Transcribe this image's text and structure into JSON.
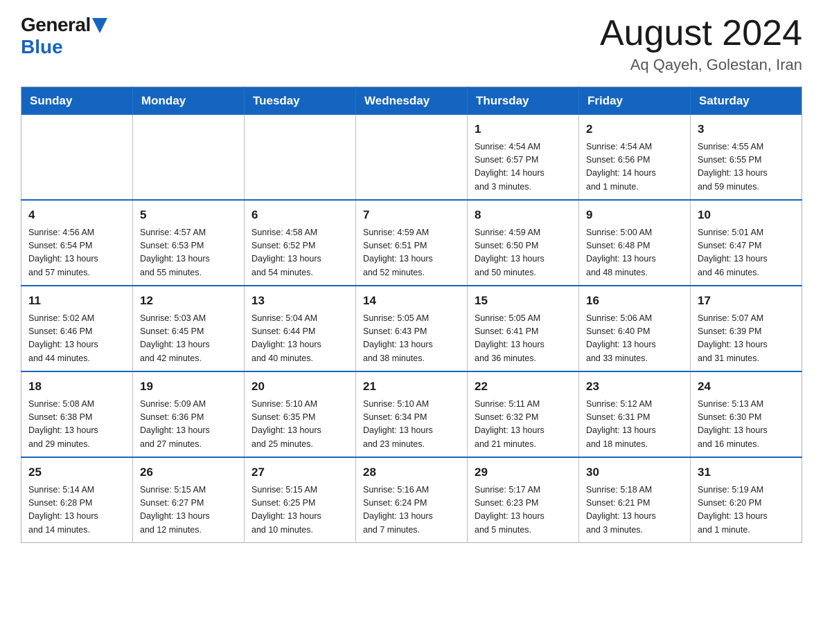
{
  "logo": {
    "general": "General",
    "blue": "Blue"
  },
  "header": {
    "month": "August 2024",
    "location": "Aq Qayeh, Golestan, Iran"
  },
  "days_of_week": [
    "Sunday",
    "Monday",
    "Tuesday",
    "Wednesday",
    "Thursday",
    "Friday",
    "Saturday"
  ],
  "weeks": [
    [
      {
        "day": "",
        "info": ""
      },
      {
        "day": "",
        "info": ""
      },
      {
        "day": "",
        "info": ""
      },
      {
        "day": "",
        "info": ""
      },
      {
        "day": "1",
        "info": "Sunrise: 4:54 AM\nSunset: 6:57 PM\nDaylight: 14 hours\nand 3 minutes."
      },
      {
        "day": "2",
        "info": "Sunrise: 4:54 AM\nSunset: 6:56 PM\nDaylight: 14 hours\nand 1 minute."
      },
      {
        "day": "3",
        "info": "Sunrise: 4:55 AM\nSunset: 6:55 PM\nDaylight: 13 hours\nand 59 minutes."
      }
    ],
    [
      {
        "day": "4",
        "info": "Sunrise: 4:56 AM\nSunset: 6:54 PM\nDaylight: 13 hours\nand 57 minutes."
      },
      {
        "day": "5",
        "info": "Sunrise: 4:57 AM\nSunset: 6:53 PM\nDaylight: 13 hours\nand 55 minutes."
      },
      {
        "day": "6",
        "info": "Sunrise: 4:58 AM\nSunset: 6:52 PM\nDaylight: 13 hours\nand 54 minutes."
      },
      {
        "day": "7",
        "info": "Sunrise: 4:59 AM\nSunset: 6:51 PM\nDaylight: 13 hours\nand 52 minutes."
      },
      {
        "day": "8",
        "info": "Sunrise: 4:59 AM\nSunset: 6:50 PM\nDaylight: 13 hours\nand 50 minutes."
      },
      {
        "day": "9",
        "info": "Sunrise: 5:00 AM\nSunset: 6:48 PM\nDaylight: 13 hours\nand 48 minutes."
      },
      {
        "day": "10",
        "info": "Sunrise: 5:01 AM\nSunset: 6:47 PM\nDaylight: 13 hours\nand 46 minutes."
      }
    ],
    [
      {
        "day": "11",
        "info": "Sunrise: 5:02 AM\nSunset: 6:46 PM\nDaylight: 13 hours\nand 44 minutes."
      },
      {
        "day": "12",
        "info": "Sunrise: 5:03 AM\nSunset: 6:45 PM\nDaylight: 13 hours\nand 42 minutes."
      },
      {
        "day": "13",
        "info": "Sunrise: 5:04 AM\nSunset: 6:44 PM\nDaylight: 13 hours\nand 40 minutes."
      },
      {
        "day": "14",
        "info": "Sunrise: 5:05 AM\nSunset: 6:43 PM\nDaylight: 13 hours\nand 38 minutes."
      },
      {
        "day": "15",
        "info": "Sunrise: 5:05 AM\nSunset: 6:41 PM\nDaylight: 13 hours\nand 36 minutes."
      },
      {
        "day": "16",
        "info": "Sunrise: 5:06 AM\nSunset: 6:40 PM\nDaylight: 13 hours\nand 33 minutes."
      },
      {
        "day": "17",
        "info": "Sunrise: 5:07 AM\nSunset: 6:39 PM\nDaylight: 13 hours\nand 31 minutes."
      }
    ],
    [
      {
        "day": "18",
        "info": "Sunrise: 5:08 AM\nSunset: 6:38 PM\nDaylight: 13 hours\nand 29 minutes."
      },
      {
        "day": "19",
        "info": "Sunrise: 5:09 AM\nSunset: 6:36 PM\nDaylight: 13 hours\nand 27 minutes."
      },
      {
        "day": "20",
        "info": "Sunrise: 5:10 AM\nSunset: 6:35 PM\nDaylight: 13 hours\nand 25 minutes."
      },
      {
        "day": "21",
        "info": "Sunrise: 5:10 AM\nSunset: 6:34 PM\nDaylight: 13 hours\nand 23 minutes."
      },
      {
        "day": "22",
        "info": "Sunrise: 5:11 AM\nSunset: 6:32 PM\nDaylight: 13 hours\nand 21 minutes."
      },
      {
        "day": "23",
        "info": "Sunrise: 5:12 AM\nSunset: 6:31 PM\nDaylight: 13 hours\nand 18 minutes."
      },
      {
        "day": "24",
        "info": "Sunrise: 5:13 AM\nSunset: 6:30 PM\nDaylight: 13 hours\nand 16 minutes."
      }
    ],
    [
      {
        "day": "25",
        "info": "Sunrise: 5:14 AM\nSunset: 6:28 PM\nDaylight: 13 hours\nand 14 minutes."
      },
      {
        "day": "26",
        "info": "Sunrise: 5:15 AM\nSunset: 6:27 PM\nDaylight: 13 hours\nand 12 minutes."
      },
      {
        "day": "27",
        "info": "Sunrise: 5:15 AM\nSunset: 6:25 PM\nDaylight: 13 hours\nand 10 minutes."
      },
      {
        "day": "28",
        "info": "Sunrise: 5:16 AM\nSunset: 6:24 PM\nDaylight: 13 hours\nand 7 minutes."
      },
      {
        "day": "29",
        "info": "Sunrise: 5:17 AM\nSunset: 6:23 PM\nDaylight: 13 hours\nand 5 minutes."
      },
      {
        "day": "30",
        "info": "Sunrise: 5:18 AM\nSunset: 6:21 PM\nDaylight: 13 hours\nand 3 minutes."
      },
      {
        "day": "31",
        "info": "Sunrise: 5:19 AM\nSunset: 6:20 PM\nDaylight: 13 hours\nand 1 minute."
      }
    ]
  ]
}
